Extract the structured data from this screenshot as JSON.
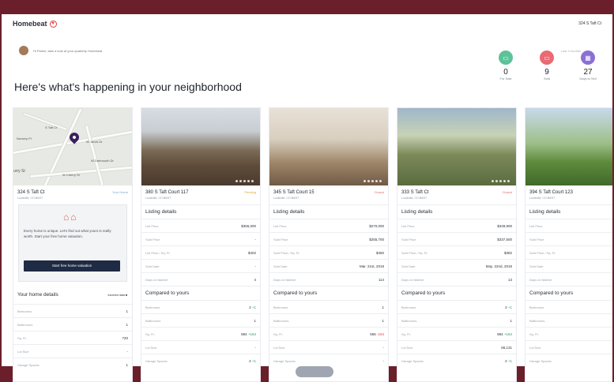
{
  "header": {
    "logo": "Homebeat",
    "address": "324 S Taft Ct"
  },
  "greeting": "Hi Parimi, take a look at your quarterly Homebeat",
  "headline": "Here's what's happening in your neighborhood",
  "stats_caption": "Last 3 months",
  "stats": [
    {
      "value": "0",
      "label": "For Sale",
      "icon": "for-sale-icon",
      "color": "#5dc29a"
    },
    {
      "value": "9",
      "label": "Sold",
      "icon": "sold-icon",
      "color": "#e96a72"
    },
    {
      "value": "27",
      "label": "Days to Sell",
      "icon": "calendar-icon",
      "color": "#8b6fd6"
    }
  ],
  "home_card": {
    "map_labels": [
      "Nursery Pl",
      "S Taft Ct",
      "W Jarvis Dr",
      "W Dartmouth Dr",
      "W Cherry St",
      "urry St"
    ],
    "address": "324 S Taft Ct",
    "city": "Louisville, CO 80027",
    "status": "Your Home",
    "valuation_text": "Every home is unique. Let's find out what yours is really worth. Start your free home valuation.",
    "valuation_button": "Start free home valuation",
    "details_title": "Your home details",
    "incorrect": "Incorrect data",
    "details": [
      {
        "label": "Bedrooms",
        "value": "1"
      },
      {
        "label": "Bathrooms",
        "value": "1"
      },
      {
        "label": "Sq. Ft.",
        "value": "720"
      },
      {
        "label": "Lot Size",
        "value": "-"
      },
      {
        "label": "Garage Spaces",
        "value": "1"
      }
    ]
  },
  "listings": [
    {
      "address": "380 S Taft Court 117",
      "city": "Louisville, CO 80027",
      "status": "Pending",
      "status_color": "#e0a23a",
      "rows": [
        [
          "List Price",
          "$355,000"
        ],
        [
          "Sold Price",
          "-"
        ],
        [
          "List Price / Sq. Ft.",
          "$402"
        ],
        [
          "Sold Date",
          "-"
        ],
        [
          "Days on Market",
          "4"
        ]
      ],
      "compare": [
        [
          "Bedrooms",
          "2",
          "+1",
          "up"
        ],
        [
          "Bathrooms",
          "1",
          "",
          ""
        ],
        [
          "Sq. Ft.",
          "884",
          "+164",
          "up"
        ],
        [
          "Lot Size",
          "-",
          "",
          ""
        ],
        [
          "Garage Spaces",
          "2",
          "+1",
          "up"
        ]
      ]
    },
    {
      "address": "345 S Taft Court 15",
      "city": "Louisville, CO 80027",
      "status": "Closed",
      "status_color": "#e06a6a",
      "rows": [
        [
          "List Price",
          "$270,000"
        ],
        [
          "Sold Price",
          "$255,700"
        ],
        [
          "Sold Price / Sq. Ft.",
          "$460"
        ],
        [
          "Sold Date",
          "Mar. 21st, 2019"
        ],
        [
          "Days on Market",
          "114"
        ]
      ],
      "compare": [
        [
          "Bedrooms",
          "1",
          "",
          ""
        ],
        [
          "Bathrooms",
          "1",
          "",
          ""
        ],
        [
          "Sq. Ft.",
          "556",
          "-164",
          "down"
        ],
        [
          "Lot Size",
          "-",
          "",
          ""
        ],
        [
          "Garage Spaces",
          "-",
          "",
          ""
        ]
      ]
    },
    {
      "address": "333 S Taft Ct",
      "city": "Louisville, CO 80027",
      "status": "Closed",
      "status_color": "#e06a6a",
      "rows": [
        [
          "List Price",
          "$349,900"
        ],
        [
          "Sold Price",
          "$337,500"
        ],
        [
          "Sold Price / Sq. Ft.",
          "$382"
        ],
        [
          "Sold Date",
          "May. 22nd, 2019"
        ],
        [
          "Days on Market",
          "13"
        ]
      ],
      "compare": [
        [
          "Bedrooms",
          "2",
          "+1",
          "up"
        ],
        [
          "Bathrooms",
          "1",
          "",
          ""
        ],
        [
          "Sq. Ft.",
          "884",
          "+164",
          "up"
        ],
        [
          "Lot Size",
          "65,131",
          "",
          ""
        ],
        [
          "Garage Spaces",
          "2",
          "+1",
          "up"
        ]
      ]
    },
    {
      "address": "394 S Taft Court 123",
      "city": "Louisville, CO 80027",
      "status": "",
      "status_color": "#e06a6a",
      "rows": [
        [
          "List Price",
          ""
        ],
        [
          "Sold Price",
          ""
        ],
        [
          "Sold Price / Sq. Ft.",
          ""
        ],
        [
          "Sold Date",
          "Jul."
        ],
        [
          "Days on Market",
          ""
        ]
      ],
      "compare": [
        [
          "Bedrooms",
          "",
          "",
          ""
        ],
        [
          "Bathrooms",
          "",
          "",
          ""
        ],
        [
          "Sq. Ft.",
          "",
          "",
          ""
        ],
        [
          "Lot Size",
          "",
          "",
          ""
        ],
        [
          "Garage Spaces",
          "",
          "",
          ""
        ]
      ]
    }
  ],
  "section_labels": {
    "listing": "Listing details",
    "compare": "Compared to yours"
  }
}
